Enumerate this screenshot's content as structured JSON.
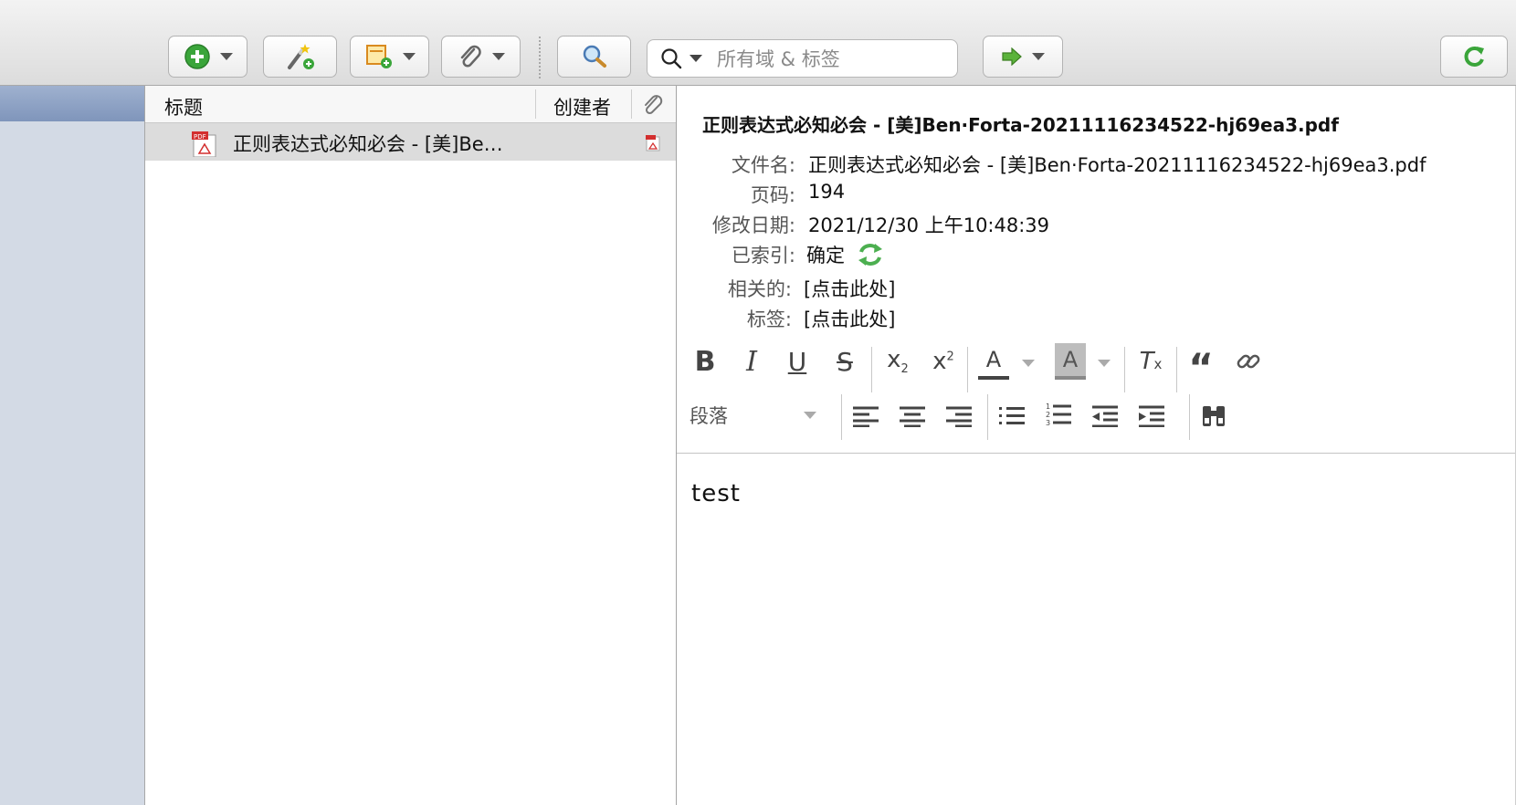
{
  "toolbar": {
    "search_placeholder": "所有域 & 标签"
  },
  "items_pane": {
    "col_title": "标题",
    "col_creator": "创建者",
    "rows": [
      {
        "title": "正则表达式必知必会 - [美]Be…"
      }
    ]
  },
  "detail": {
    "attachment_title": "正则表达式必知必会 - [美]Ben·Forta-20211116234522-hj69ea3.pdf",
    "filename_label": "文件名:",
    "filename_value": "正则表达式必知必会 - [美]Ben·Forta-20211116234522-hj69ea3.pdf",
    "pages_label": "页码:",
    "pages_value": "194",
    "modified_label": "修改日期:",
    "modified_value": "2021/12/30 上午10:48:39",
    "indexed_label": "已索引:",
    "indexed_value": "确定",
    "related_label": "相关的:",
    "related_value": "[点击此处]",
    "tags_label": "标签:",
    "tags_value": "[点击此处]"
  },
  "editor": {
    "format_select": "段落",
    "content": "test",
    "font_color_letter": "A",
    "highlight_letter": "A"
  },
  "colors": {
    "sidebar_bg": "#d3dae5",
    "sidebar_selected": "#8a9dc0",
    "row_selected": "#dcdcdc",
    "green_icon": "#3aa53a"
  }
}
